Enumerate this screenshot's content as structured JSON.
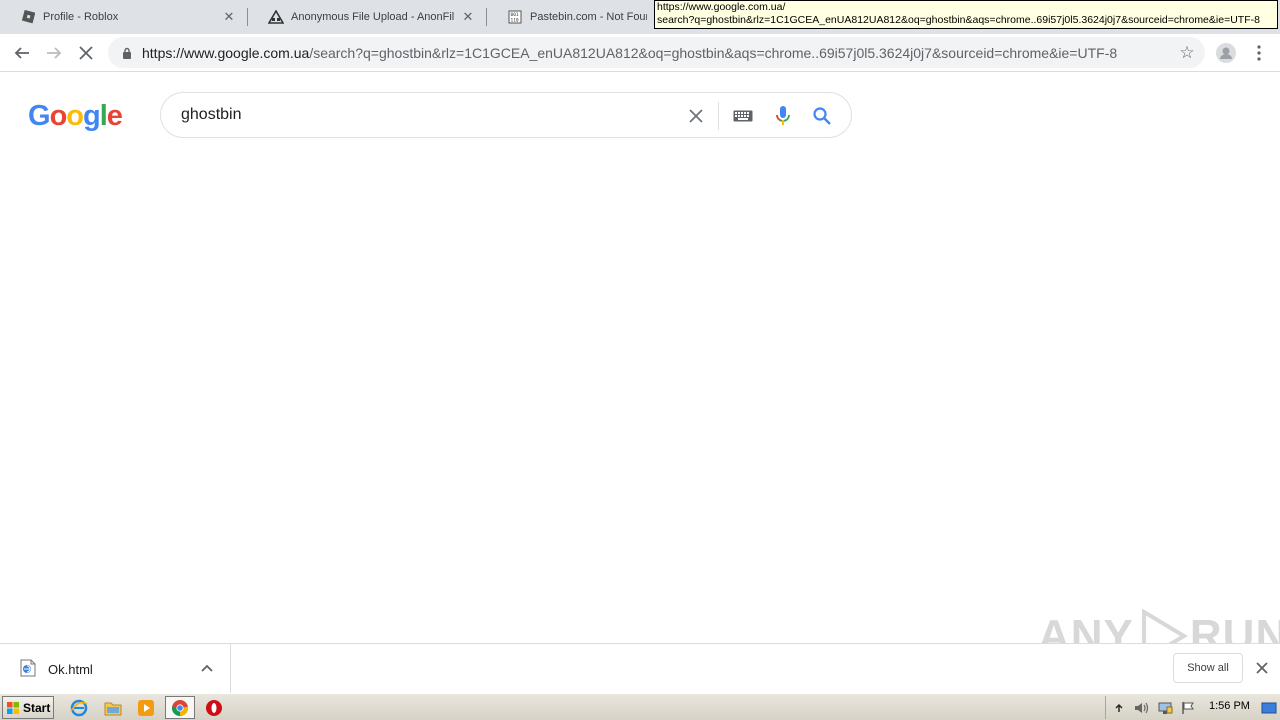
{
  "tabs": [
    {
      "title": "Profile - Roblox",
      "icon": "roblox-icon",
      "active": false
    },
    {
      "title": "Anonymous File Upload - AnonFiles",
      "icon": "anonfiles-icon",
      "active": false
    },
    {
      "title": "Pastebin.com - Not Found (",
      "icon": "pastebin-icon",
      "active": false
    }
  ],
  "tooltip": {
    "line1": "https://www.google.com.ua/",
    "line2": "search?q=ghostbin&rlz=1C1GCEA_enUA812UA812&oq=ghostbin&aqs=chrome..69i57j0l5.3624j0j7&sourceid=chrome&ie=UTF-8"
  },
  "omnibox": {
    "url_host": "https://www.google.com.ua",
    "url_rest": "/search?q=ghostbin&rlz=1C1GCEA_enUA812UA812&oq=ghostbin&aqs=chrome..69i57j0l5.3624j0j7&sourceid=chrome&ie=UTF-8"
  },
  "google": {
    "logo_letters": [
      "G",
      "o",
      "o",
      "g",
      "l",
      "e"
    ],
    "logo_colors": [
      "#4285f4",
      "#ea4335",
      "#fbbc05",
      "#4285f4",
      "#34a853",
      "#ea4335"
    ],
    "query": "ghostbin"
  },
  "downloads": {
    "file_name": "Ok.html",
    "show_all_label": "Show all"
  },
  "watermark": {
    "text_left": "ANY",
    "text_right": "RUN"
  },
  "taskbar": {
    "start_label": "Start",
    "clock": "1:56 PM"
  },
  "colors": {
    "tab_strip": "#dee1e6",
    "omnibox_bg": "#f1f3f4",
    "google_blue": "#4285f4"
  }
}
